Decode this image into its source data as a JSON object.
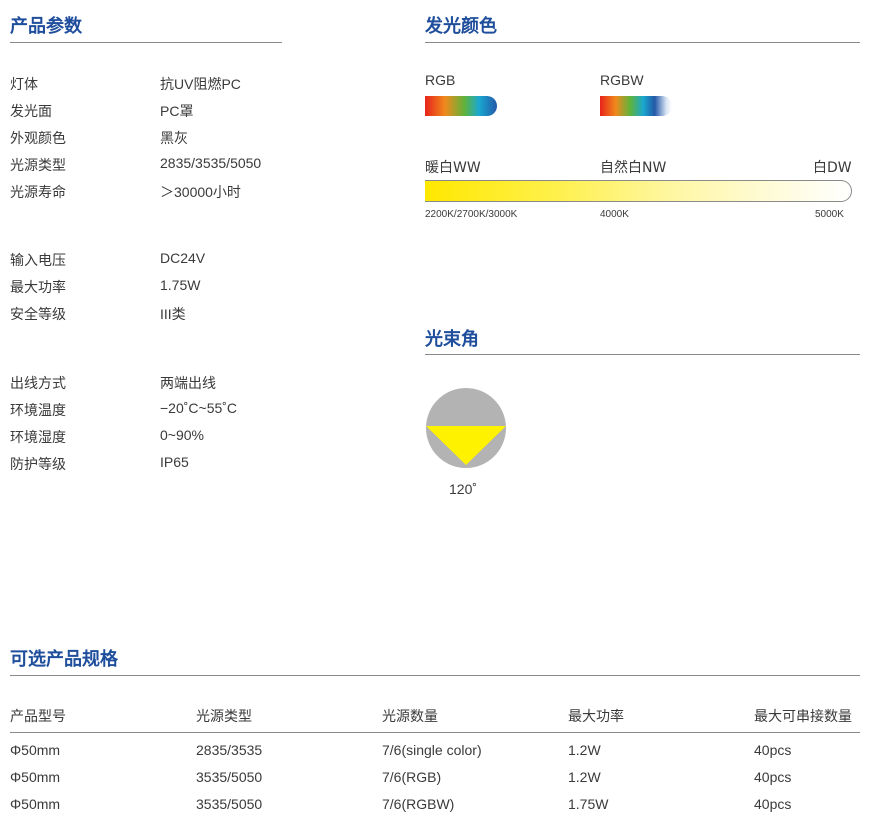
{
  "params": {
    "title": "产品参数",
    "groups": [
      [
        {
          "label": "灯体",
          "value": "抗UV阻燃PC"
        },
        {
          "label": "发光面",
          "value": "PC罩"
        },
        {
          "label": "外观颜色",
          "value": "黑灰"
        },
        {
          "label": "光源类型",
          "value": "2835/3535/5050"
        },
        {
          "label": "光源寿命",
          "value": "＞30000小时"
        }
      ],
      [
        {
          "label": "输入电压",
          "value": "DC24V"
        },
        {
          "label": "最大功率",
          "value": "1.75W"
        },
        {
          "label": "安全等级",
          "value": "III类"
        }
      ],
      [
        {
          "label": "出线方式",
          "value": "两端出线"
        },
        {
          "label": "环境温度",
          "value": "−20˚C~55˚C"
        },
        {
          "label": "环境湿度",
          "value": "0~90%"
        },
        {
          "label": "防护等级",
          "value": "IP65"
        }
      ]
    ]
  },
  "colors": {
    "title": "发光颜色",
    "rgb_label": "RGB",
    "rgbw_label": "RGBW",
    "ww_label": "暖白WW",
    "nw_label": "自然白NW",
    "dw_label": "白DW",
    "kelvin_ww": "2200K/2700K/3000K",
    "kelvin_nw": "4000K",
    "kelvin_dw": "5000K"
  },
  "beam": {
    "title": "光束角",
    "angle": "120˚",
    "angle_degrees": 120
  },
  "specs": {
    "title": "可选产品规格",
    "headers": [
      "产品型号",
      "光源类型",
      "光源数量",
      "最大功率",
      "最大可串接数量"
    ],
    "rows": [
      [
        "Φ50mm",
        "2835/3535",
        "7/6(single color)",
        "1.2W",
        "40pcs"
      ],
      [
        "Φ50mm",
        "3535/5050",
        "7/6(RGB)",
        "1.2W",
        "40pcs"
      ],
      [
        "Φ50mm",
        "3535/5050",
        "7/6(RGBW)",
        "1.75W",
        "40pcs"
      ]
    ]
  },
  "palette": {
    "heading": "#1f4e9c",
    "rule": "#8a8a8a",
    "beam_body": "#b3b3b3",
    "beam_light": "#fff200",
    "warm": "#ffe800"
  }
}
